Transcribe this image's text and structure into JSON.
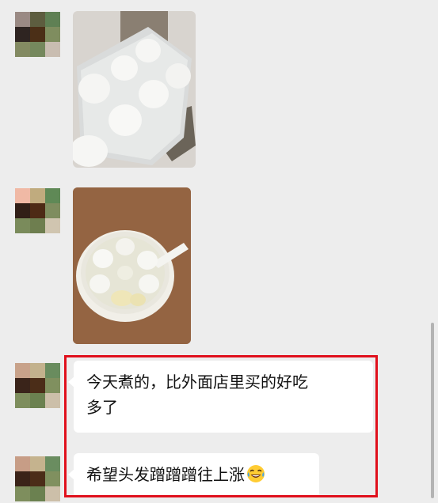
{
  "messages": [
    {
      "type": "image",
      "content_icon": "tangyuan-tray-photo-icon",
      "avatar_colors": [
        "#9a8a84",
        "#5d5d3f",
        "#5f8054",
        "#2e2421",
        "#4b2f17",
        "#7f8d5f",
        "#838a62",
        "#75885d",
        "#c9bdb1"
      ]
    },
    {
      "type": "image",
      "content_icon": "tangyuan-bowl-photo-icon",
      "avatar_colors": [
        "#f0b9a5",
        "#c0ab7e",
        "#5f8956",
        "#311f17",
        "#4d2a15",
        "#7f8d5f",
        "#7a8b5b",
        "#6e7e4f",
        "#d0c5b0"
      ]
    },
    {
      "type": "text",
      "text": "今天煮的，比外面店里买的好吃多了",
      "line1": "今天煮的，比外面店里买的好吃",
      "line2": "多了",
      "avatar_colors": [
        "#c8a28a",
        "#c3b28d",
        "#698c5e",
        "#3a241a",
        "#4b2d18",
        "#80905f",
        "#7e8e5d",
        "#6b8150",
        "#ccbfa9"
      ]
    },
    {
      "type": "text",
      "text": "希望头发蹭蹭蹭往上涨",
      "emoji": "face-with-tears-of-joy-icon",
      "avatar_colors": [
        "#c79d86",
        "#c5b38e",
        "#6a8d60",
        "#3a2318",
        "#4b2d18",
        "#80905f",
        "#7e8e5d",
        "#6b8150",
        "#ccbfa9"
      ]
    }
  ],
  "highlight_color": "#e0101c"
}
